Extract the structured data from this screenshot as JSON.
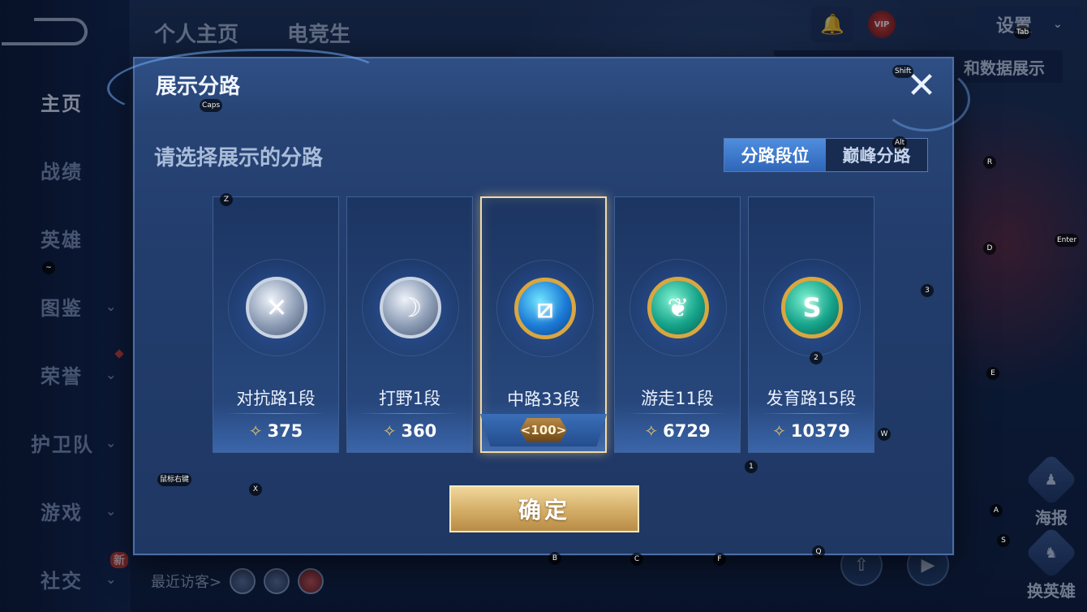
{
  "background": {
    "nav": {
      "items": [
        {
          "label": "主页",
          "chevron": false,
          "active": true
        },
        {
          "label": "战绩",
          "chevron": false,
          "active": false
        },
        {
          "label": "英雄",
          "chevron": false,
          "active": false
        },
        {
          "label": "图鉴",
          "chevron": true,
          "active": false
        },
        {
          "label": "荣誉",
          "chevron": true,
          "active": false
        },
        {
          "label": "护卫队",
          "chevron": true,
          "active": false
        },
        {
          "label": "游戏",
          "chevron": true,
          "active": false
        },
        {
          "label": "社交",
          "chevron": true,
          "active": false
        }
      ],
      "new_badge": "新"
    },
    "top_tabs": [
      "个人主页",
      "电竞生"
    ],
    "vip_label": "VIP",
    "settings_label": "设置",
    "data_banner": "和数据展示",
    "right_buttons": [
      "海报",
      "换英雄"
    ],
    "visitors_label": "最近访客>"
  },
  "dialog": {
    "title": "展示分路",
    "subtitle": "请选择展示的分路",
    "close_icon": "close-icon",
    "toggle": [
      {
        "label": "分路段位",
        "active": true
      },
      {
        "label": "巅峰分路",
        "active": false
      }
    ],
    "cards": [
      {
        "lane": "对抗路1段",
        "score": "375",
        "medal": "silver",
        "glyph": "✕",
        "selected": false
      },
      {
        "lane": "打野1段",
        "score": "360",
        "medal": "silver",
        "glyph": "☽",
        "selected": false
      },
      {
        "lane": "中路33段",
        "score": "100",
        "medal": "gold-blue",
        "glyph": "⧄",
        "selected": true
      },
      {
        "lane": "游走11段",
        "score": "6729",
        "medal": "gold-green",
        "glyph": "❦",
        "selected": false
      },
      {
        "lane": "发育路15段",
        "score": "10379",
        "medal": "gold-green",
        "glyph": "S",
        "selected": false
      }
    ],
    "confirm_label": "确定"
  },
  "key_hints": [
    {
      "key": "Caps"
    },
    {
      "key": "Shift"
    },
    {
      "key": "Tab"
    },
    {
      "key": "Alt"
    },
    {
      "key": "R"
    },
    {
      "key": "Enter"
    },
    {
      "key": "D"
    },
    {
      "key": "3"
    },
    {
      "key": "Z"
    },
    {
      "key": "2"
    },
    {
      "key": "E"
    },
    {
      "key": "W"
    },
    {
      "key": "1"
    },
    {
      "key": "鼠标右键"
    },
    {
      "key": "X"
    },
    {
      "key": "A"
    },
    {
      "key": "S"
    },
    {
      "key": "Q"
    },
    {
      "key": "B"
    },
    {
      "key": "C"
    },
    {
      "key": "F"
    },
    {
      "key": "~"
    }
  ],
  "colors": {
    "panel": "#223d6c",
    "accent_blue": "#3f7fd6",
    "gold": "#d6b06a",
    "selected_border": "#f1d9a6"
  }
}
